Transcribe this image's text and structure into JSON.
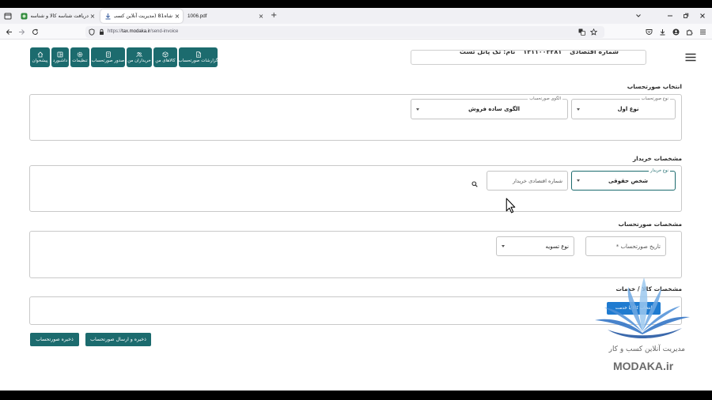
{
  "browser": {
    "tabs": [
      {
        "title": "دریافت شناسه کالا و شناسه خد",
        "favicon": "site-logo-icon",
        "close": "×",
        "active": false
      },
      {
        "title": "شاه81 (مدیریت آنلاین کسب و کا",
        "favicon": "download-icon",
        "close": "×",
        "active": true
      },
      {
        "title": "1006.pdf",
        "close": "×",
        "active": false
      }
    ],
    "new_tab": "+",
    "url": {
      "scheme": "https://",
      "host": "tax.modaka.ir",
      "path": "/send-invoice"
    }
  },
  "header": {
    "taxpayer": {
      "economic_code_label": "شماره اقتصادی",
      "economic_code": "۱۴۱۱۰۰۳۲۸۱",
      "name": "نام: تک پانل تست"
    },
    "toolbar": [
      {
        "label": "پیشخوان",
        "icon": "home-icon"
      },
      {
        "label": "داشبورد",
        "icon": "dashboard-icon"
      },
      {
        "label": "تنظیمات",
        "icon": "gear-icon"
      },
      {
        "label": "صدور صورتحساب",
        "icon": "invoice-icon"
      },
      {
        "label": "خریداران من",
        "icon": "users-icon"
      },
      {
        "label": "کالاهای من",
        "icon": "box-icon"
      },
      {
        "label": "گزارشات صورتحساب",
        "icon": "report-icon"
      }
    ]
  },
  "invoice_selection": {
    "title": "انتخاب صورتحساب",
    "invoice_type": {
      "label": "نوع صورتحساب",
      "value": "نوع اول"
    },
    "invoice_pattern": {
      "label": "الگوی صورتحساب",
      "value": "الگوی ساده فروش"
    }
  },
  "buyer": {
    "title": "مشخصات خریدار",
    "buyer_type": {
      "label": "نوع خریدار",
      "value": "شخص حقوقی"
    },
    "economic_code": {
      "placeholder": "شماره اقتصادی خریدار"
    }
  },
  "invoice_details": {
    "title": "مشخصات صورتحساب",
    "date": {
      "placeholder": "تاریخ صورتحساب *"
    },
    "settlement_type": {
      "value": "نوع تسویه"
    }
  },
  "items": {
    "title": "مشخصات کالا / خدمات",
    "select_button": "انتخاب کالا یا خدمت"
  },
  "actions": {
    "save": "ذخیره صورتحساب",
    "save_and_send": "ذخیره و ارسال صورتحساب"
  },
  "watermark": {
    "tagline": "مدیریت آنلاین کسب و کار",
    "brand": "MODAKA.ir"
  },
  "colors": {
    "accent": "#1c6b6e",
    "button_blue": "#1f7bd0",
    "logo_blue": "#2a6fc4"
  }
}
